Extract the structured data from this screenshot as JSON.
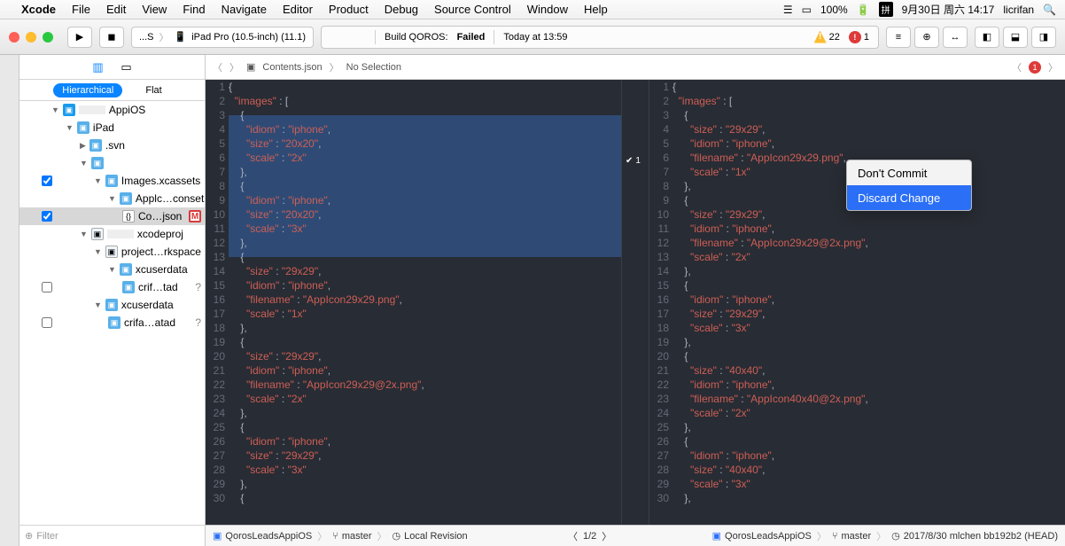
{
  "menubar": {
    "apple": "",
    "app": "Xcode",
    "items": [
      "File",
      "Edit",
      "View",
      "Find",
      "Navigate",
      "Editor",
      "Product",
      "Debug",
      "Source Control",
      "Window",
      "Help"
    ],
    "battery": "100%",
    "date": "9月30日 周六 14:17",
    "user": "licrifan"
  },
  "toolbar": {
    "scheme_left": "...S",
    "scheme_right": "iPad Pro (10.5-inch) (11.1)",
    "build_text": "Build QOROS:",
    "build_status": "Failed",
    "build_time": "Today at 13:59",
    "warn_count": "22",
    "err_count": "1"
  },
  "navigator": {
    "mode_h": "Hierarchical",
    "mode_f": "Flat",
    "tree": {
      "root": "AppiOS",
      "ipad": "iPad",
      "svn": ".svn",
      "images": "Images.xcassets",
      "applc": "Applc…conset",
      "cojson": "Co…json",
      "xcodeproj": "xcodeproj",
      "rkspace": "project…rkspace",
      "xcuser1": "xcuserdata",
      "crif1": "crif…tad",
      "xcuser2": "xcuserdata",
      "crif2": "crifa…atad"
    },
    "filter_ph": "Filter"
  },
  "jumpbar": {
    "file": "Contents.json",
    "sel": "No Selection",
    "err": "1"
  },
  "code_left": {
    "lines": [
      "{",
      "  \"images\" : [",
      "    {",
      "      \"idiom\" : \"iphone\",",
      "      \"size\" : \"20x20\",",
      "      \"scale\" : \"2x\"",
      "    },",
      "    {",
      "      \"idiom\" : \"iphone\",",
      "      \"size\" : \"20x20\",",
      "      \"scale\" : \"3x\"",
      "    },",
      "    {",
      "      \"size\" : \"29x29\",",
      "      \"idiom\" : \"iphone\",",
      "      \"filename\" : \"AppIcon29x29.png\",",
      "      \"scale\" : \"1x\"",
      "    },",
      "    {",
      "      \"size\" : \"29x29\",",
      "      \"idiom\" : \"iphone\",",
      "      \"filename\" : \"AppIcon29x29@2x.png\",",
      "      \"scale\" : \"2x\"",
      "    },",
      "    {",
      "      \"idiom\" : \"iphone\",",
      "      \"size\" : \"29x29\",",
      "      \"scale\" : \"3x\"",
      "    },",
      "    {"
    ]
  },
  "code_right": {
    "lines": [
      "{",
      "  \"images\" : [",
      "    {",
      "      \"size\" : \"29x29\",",
      "      \"idiom\" : \"iphone\",",
      "      \"filename\" : \"AppIcon29x29.png\",",
      "      \"scale\" : \"1x\"",
      "    },",
      "    {",
      "      \"size\" : \"29x29\",",
      "      \"idiom\" : \"iphone\",",
      "      \"filename\" : \"AppIcon29x29@2x.png\",",
      "      \"scale\" : \"2x\"",
      "    },",
      "    {",
      "      \"idiom\" : \"iphone\",",
      "      \"size\" : \"29x29\",",
      "      \"scale\" : \"3x\"",
      "    },",
      "    {",
      "      \"size\" : \"40x40\",",
      "      \"idiom\" : \"iphone\",",
      "      \"filename\" : \"AppIcon40x40@2x.png\",",
      "      \"scale\" : \"2x\"",
      "    },",
      "    {",
      "      \"idiom\" : \"iphone\",",
      "      \"size\" : \"40x40\",",
      "      \"scale\" : \"3x\"",
      "    },"
    ]
  },
  "divider": {
    "num": "1"
  },
  "contextmenu": {
    "dont": "Don't Commit",
    "discard": "Discard Change"
  },
  "bottombar": {
    "proj": "QorosLeadsAppiOS",
    "branch": "master",
    "local": "Local Revision",
    "pos": "1/2",
    "commit": "2017/8/30  mlchen  bb192b2 (HEAD)"
  }
}
